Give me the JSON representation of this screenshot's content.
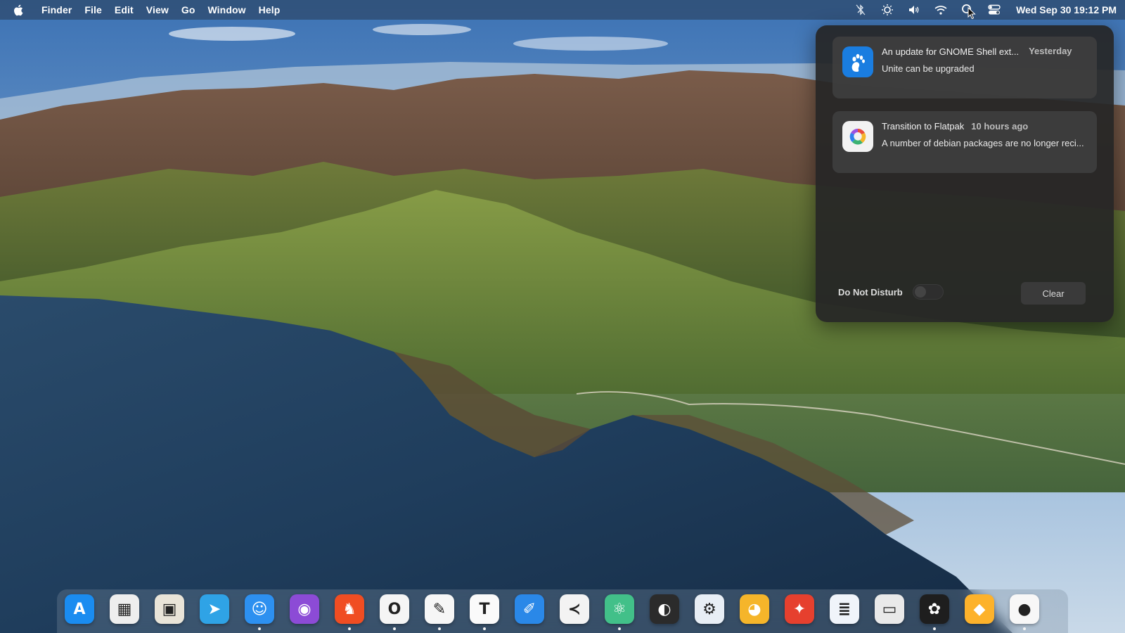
{
  "menubar": {
    "app_name": "Finder",
    "menus": [
      "File",
      "Edit",
      "View",
      "Go",
      "Window",
      "Help"
    ],
    "tray_icons": [
      "bluetooth-icon",
      "brightness-icon",
      "volume-icon",
      "wifi-icon",
      "search-icon",
      "control-center-icon"
    ],
    "clock": "Wed Sep 30  19:12 PM"
  },
  "notifications": {
    "items": [
      {
        "title": "An update for GNOME Shell ext...",
        "time": "Yesterday",
        "body": "Unite can be upgraded",
        "icon": "gnome-foot-icon",
        "icon_color": "#1a7de0"
      },
      {
        "title": "Transition to Flatpak",
        "time": "10 hours ago",
        "body": "A number of debian packages are no longer reci...",
        "icon": "flatpak-cycle-icon",
        "icon_color": "#f2f2f2"
      }
    ],
    "dnd_label": "Do Not Disturb",
    "dnd_enabled": false,
    "clear_label": "Clear"
  },
  "dock": {
    "items": [
      {
        "name": "app-store-icon",
        "glyph": "A",
        "color": "#1a8cf0",
        "running": false
      },
      {
        "name": "launchpad-icon",
        "glyph": "▦",
        "color": "#eeeeee",
        "running": false
      },
      {
        "name": "archive-box-icon",
        "glyph": "▣",
        "color": "#e9e4d8",
        "running": false
      },
      {
        "name": "telegram-icon",
        "glyph": "➤",
        "color": "#2fa3e6",
        "running": false
      },
      {
        "name": "finder-icon",
        "glyph": "☺",
        "color": "#2d90f0",
        "running": true
      },
      {
        "name": "firefox-icon",
        "glyph": "◉",
        "color": "#8c4bd6",
        "running": false
      },
      {
        "name": "brave-icon",
        "glyph": "♞",
        "color": "#f04d22",
        "running": true
      },
      {
        "name": "opera-icon",
        "glyph": "O",
        "color": "#f5f5f5",
        "running": true
      },
      {
        "name": "text-editor-icon",
        "glyph": "✎",
        "color": "#f6f6f6",
        "running": true
      },
      {
        "name": "typora-icon",
        "glyph": "T",
        "color": "#fafafa",
        "running": true
      },
      {
        "name": "xcode-icon",
        "glyph": "✐",
        "color": "#2a88e8",
        "running": false
      },
      {
        "name": "vscode-icon",
        "glyph": "≺",
        "color": "#f3f3f3",
        "running": false
      },
      {
        "name": "atom-icon",
        "glyph": "⚛",
        "color": "#42c089",
        "running": true
      },
      {
        "name": "activity-monitor-icon",
        "glyph": "◐",
        "color": "#2b2b2b",
        "running": false
      },
      {
        "name": "settings-tweaks-icon",
        "glyph": "⚙",
        "color": "#e8eef5",
        "running": false
      },
      {
        "name": "color-picker-icon",
        "glyph": "◕",
        "color": "#f5b52a",
        "running": false
      },
      {
        "name": "safari-icon",
        "glyph": "✦",
        "color": "#e6402e",
        "running": false
      },
      {
        "name": "document-viewer-icon",
        "glyph": "≣",
        "color": "#f0f4fa",
        "running": false
      },
      {
        "name": "screenshot-icon",
        "glyph": "▭",
        "color": "#e9e9e9",
        "running": false
      },
      {
        "name": "figma-icon",
        "glyph": "✿",
        "color": "#1e1e1e",
        "running": true
      },
      {
        "name": "sketch-icon",
        "glyph": "◆",
        "color": "#fdb22b",
        "running": false
      },
      {
        "name": "github-icon",
        "glyph": "●",
        "color": "#f7f7f7",
        "running": true
      }
    ]
  }
}
